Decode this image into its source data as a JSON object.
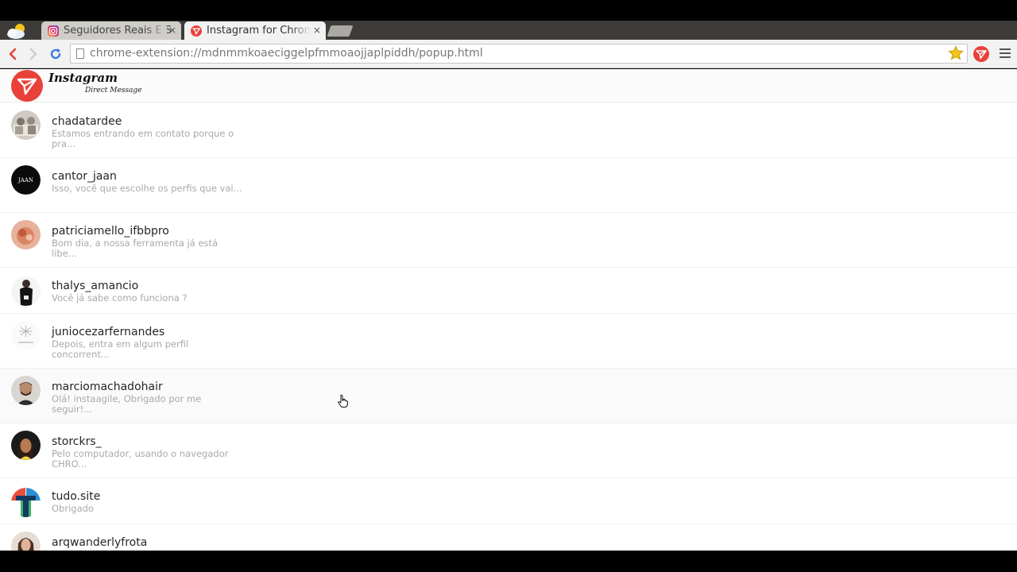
{
  "browser": {
    "tabs": [
      {
        "title": "Seguidores Reais E S",
        "active": false
      },
      {
        "title": "Instagram for Chron",
        "active": true
      }
    ],
    "tab_close_glyph": "×",
    "url": "chrome-extension://mdnmmkoaeciggelpfmmoaojjaplpiddh/popup.html",
    "icons": [
      "back-icon",
      "forward-icon",
      "reload-icon",
      "page-icon",
      "star-icon",
      "extension-icon",
      "menu-icon"
    ]
  },
  "app": {
    "brand": "Instagram",
    "brand_sub": "Direct Message",
    "accent": "#e8413a"
  },
  "conversations": [
    {
      "username": "chadatardee",
      "preview": "Estamos entrando em contato porque o pra..."
    },
    {
      "username": "cantor_jaan",
      "preview": "Isso, você que escolhe os perfis que vai...",
      "avatar_text": "JAAN"
    },
    {
      "username": "patriciamello_ifbbpro",
      "preview": "Bom dia, a nossa ferramenta já está libe..."
    },
    {
      "username": "thalys_amancio",
      "preview": "Você já sabe como funciona ?"
    },
    {
      "username": "juniocezarfernandes",
      "preview": "Depois, entra em algum perfil concorrent..."
    },
    {
      "username": "marciomachadohair",
      "preview": "Olá! instaagile, Obrigado por me seguir!..."
    },
    {
      "username": "storckrs_",
      "preview": "Pelo computador, usando o navegador CHRO..."
    },
    {
      "username": "tudo.site",
      "preview": "Obrigado"
    },
    {
      "username": "arqwanderlyfrota",
      "preview": ""
    }
  ]
}
